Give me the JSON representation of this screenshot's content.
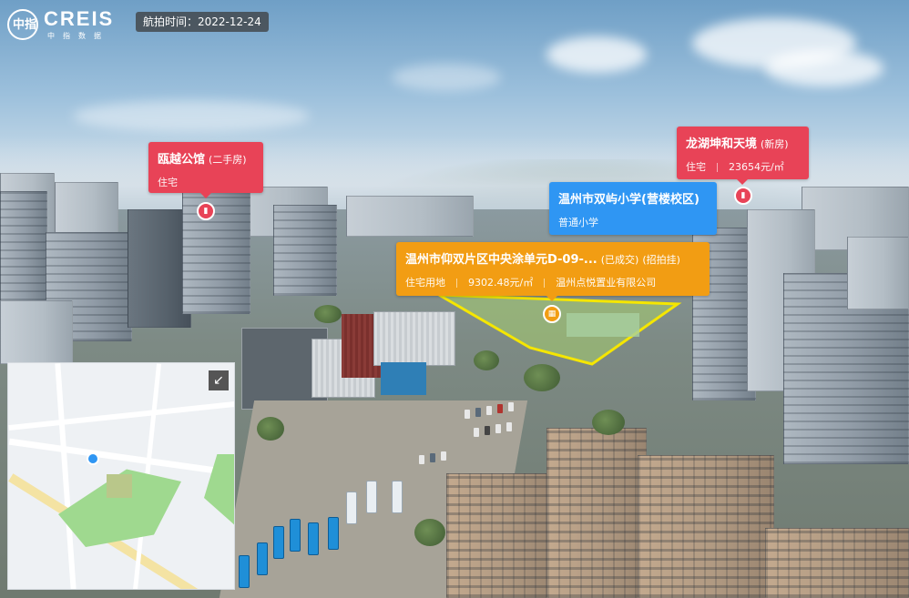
{
  "header": {
    "logo_text": "CREIS",
    "logo_mark": "中指",
    "logo_sub": "中指数据",
    "date_label": "航拍时间：2022-12-24"
  },
  "cards": {
    "ouyue": {
      "name": "瓯越公馆",
      "tag": "(二手房)",
      "type": "住宅"
    },
    "longhu": {
      "name": "龙湖坤和天境",
      "tag": "(新房)",
      "type": "住宅",
      "price": "23654元/㎡"
    },
    "school": {
      "name": "温州市双屿小学(营楼校区)",
      "type": "普通小学"
    },
    "land": {
      "name": "温州市仰双片区中央涂单元D-09-...",
      "status": "(已成交)",
      "method": "(招拍挂)",
      "type": "住宅用地",
      "price": "9302.48元/㎡",
      "buyer": "温州点悦置业有限公司"
    }
  },
  "minimap": {
    "expand_icon": "↙"
  },
  "colors": {
    "red": "#e84357",
    "blue": "#2f96f3",
    "orange": "#f29d13",
    "site_outline": "#f5e600"
  },
  "icons": {
    "pin": "building-icon",
    "expand": "collapse-arrow-icon",
    "school": "school-pin-icon"
  }
}
